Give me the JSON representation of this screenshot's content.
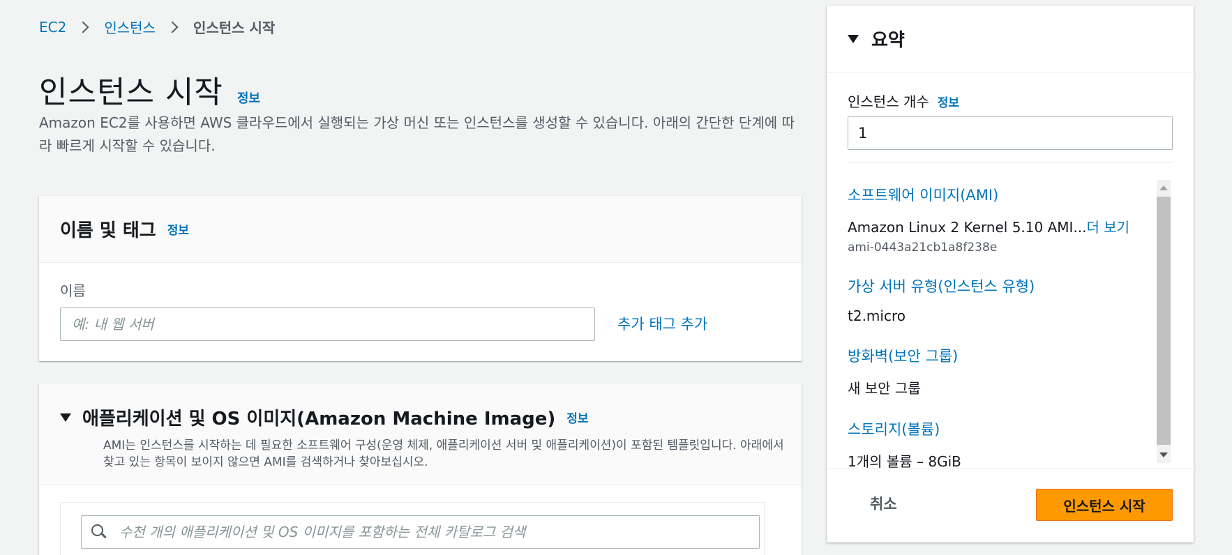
{
  "breadcrumb": {
    "items": [
      {
        "label": "EC2"
      },
      {
        "label": "인스턴스"
      },
      {
        "label": "인스턴스 시작"
      }
    ]
  },
  "page": {
    "title": "인스턴스 시작",
    "info": "정보",
    "description": "Amazon EC2를 사용하면 AWS 클라우드에서 실행되는 가상 머신 또는 인스턴스를 생성할 수 있습니다. 아래의 간단한 단계에 따라 빠르게 시작할 수 있습니다."
  },
  "name_tags": {
    "title": "이름 및 태그",
    "info": "정보",
    "name_label": "이름",
    "name_value": "",
    "name_placeholder": "예: 내 웹 서버",
    "add_tag": "추가 태그 추가"
  },
  "ami": {
    "title": "애플리케이션 및 OS 이미지(Amazon Machine Image)",
    "info": "정보",
    "description": "AMI는 인스턴스를 시작하는 데 필요한 소프트웨어 구성(운영 체제, 애플리케이션 서버 및 애플리케이션)이 포함된 템플릿입니다. 아래에서 찾고 있는 항목이 보이지 않으면 AMI를 검색하거나 찾아보십시오.",
    "search_placeholder": "수천 개의 애플리케이션 및 OS 이미지를 포함하는 전체 카탈로그 검색"
  },
  "summary": {
    "title": "요약",
    "count_label": "인스턴스 개수",
    "count_info": "정보",
    "count_value": "1",
    "ami_key": "소프트웨어 이미지(AMI)",
    "ami_value": "Amazon Linux 2 Kernel 5.10 AMI...",
    "ami_more": "더 보기",
    "ami_id": "ami-0443a21cb1a8f238e",
    "type_key": "가상 서버 유형(인스턴스 유형)",
    "type_value": "t2.micro",
    "firewall_key": "방화벽(보안 그룹)",
    "firewall_value": "새 보안 그룹",
    "storage_key": "스토리지(볼륨)",
    "storage_value": "1개의 볼륨 – 8GiB",
    "cancel": "취소",
    "launch": "인스턴스 시작"
  },
  "colors": {
    "link": "#0073bb",
    "primary_button": "#ff9900",
    "background": "#f2f3f3"
  }
}
